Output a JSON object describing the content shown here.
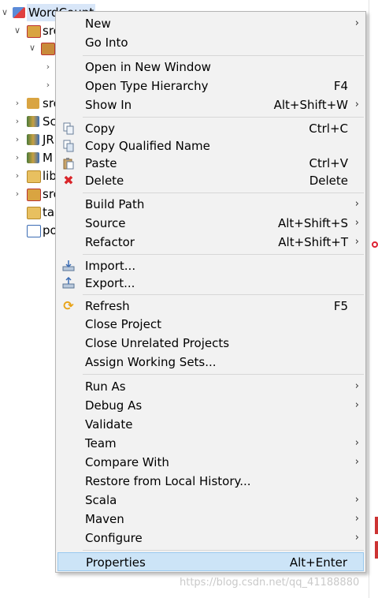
{
  "tree": {
    "root_label": "WordCount",
    "items": [
      {
        "label": "src",
        "indent": 1
      },
      {
        "label": "",
        "indent": 2
      },
      {
        "label": "",
        "indent": 3
      },
      {
        "label": "",
        "indent": 3
      },
      {
        "label": "src",
        "indent": 1
      },
      {
        "label": "Sc",
        "indent": 1
      },
      {
        "label": "JR",
        "indent": 1
      },
      {
        "label": "M",
        "indent": 1
      },
      {
        "label": "lib",
        "indent": 1
      },
      {
        "label": "src",
        "indent": 1
      },
      {
        "label": "ta",
        "indent": 1
      },
      {
        "label": "po",
        "indent": 1
      }
    ]
  },
  "menu": {
    "items": [
      {
        "label": "New",
        "shortcut": "",
        "submenu": true
      },
      {
        "label": "Go Into",
        "shortcut": "",
        "submenu": false
      },
      {
        "label": "Open in New Window",
        "shortcut": "",
        "submenu": false
      },
      {
        "label": "Open Type Hierarchy",
        "shortcut": "F4",
        "submenu": false
      },
      {
        "label": "Show In",
        "shortcut": "Alt+Shift+W",
        "submenu": true
      },
      {
        "label": "Copy",
        "shortcut": "Ctrl+C",
        "submenu": false
      },
      {
        "label": "Copy Qualified Name",
        "shortcut": "",
        "submenu": false
      },
      {
        "label": "Paste",
        "shortcut": "Ctrl+V",
        "submenu": false
      },
      {
        "label": "Delete",
        "shortcut": "Delete",
        "submenu": false
      },
      {
        "label": "Build Path",
        "shortcut": "",
        "submenu": true
      },
      {
        "label": "Source",
        "shortcut": "Alt+Shift+S",
        "submenu": true
      },
      {
        "label": "Refactor",
        "shortcut": "Alt+Shift+T",
        "submenu": true
      },
      {
        "label": "Import...",
        "shortcut": "",
        "submenu": false
      },
      {
        "label": "Export...",
        "shortcut": "",
        "submenu": false
      },
      {
        "label": "Refresh",
        "shortcut": "F5",
        "submenu": false
      },
      {
        "label": "Close Project",
        "shortcut": "",
        "submenu": false
      },
      {
        "label": "Close Unrelated Projects",
        "shortcut": "",
        "submenu": false
      },
      {
        "label": "Assign Working Sets...",
        "shortcut": "",
        "submenu": false
      },
      {
        "label": "Run As",
        "shortcut": "",
        "submenu": true
      },
      {
        "label": "Debug As",
        "shortcut": "",
        "submenu": true
      },
      {
        "label": "Validate",
        "shortcut": "",
        "submenu": false
      },
      {
        "label": "Team",
        "shortcut": "",
        "submenu": true
      },
      {
        "label": "Compare With",
        "shortcut": "",
        "submenu": true
      },
      {
        "label": "Restore from Local History...",
        "shortcut": "",
        "submenu": false
      },
      {
        "label": "Scala",
        "shortcut": "",
        "submenu": true
      },
      {
        "label": "Maven",
        "shortcut": "",
        "submenu": true
      },
      {
        "label": "Configure",
        "shortcut": "",
        "submenu": true
      },
      {
        "label": "Properties",
        "shortcut": "Alt+Enter",
        "submenu": false
      }
    ]
  },
  "watermark": "https://blog.csdn.net/qq_41188880",
  "colors": {
    "menu_bg": "#f2f2f2",
    "selected_bg": "#cce4f7",
    "selected_border": "#99c9ef",
    "delete_icon": "#d9252a",
    "refresh_icon": "#e8a317"
  }
}
